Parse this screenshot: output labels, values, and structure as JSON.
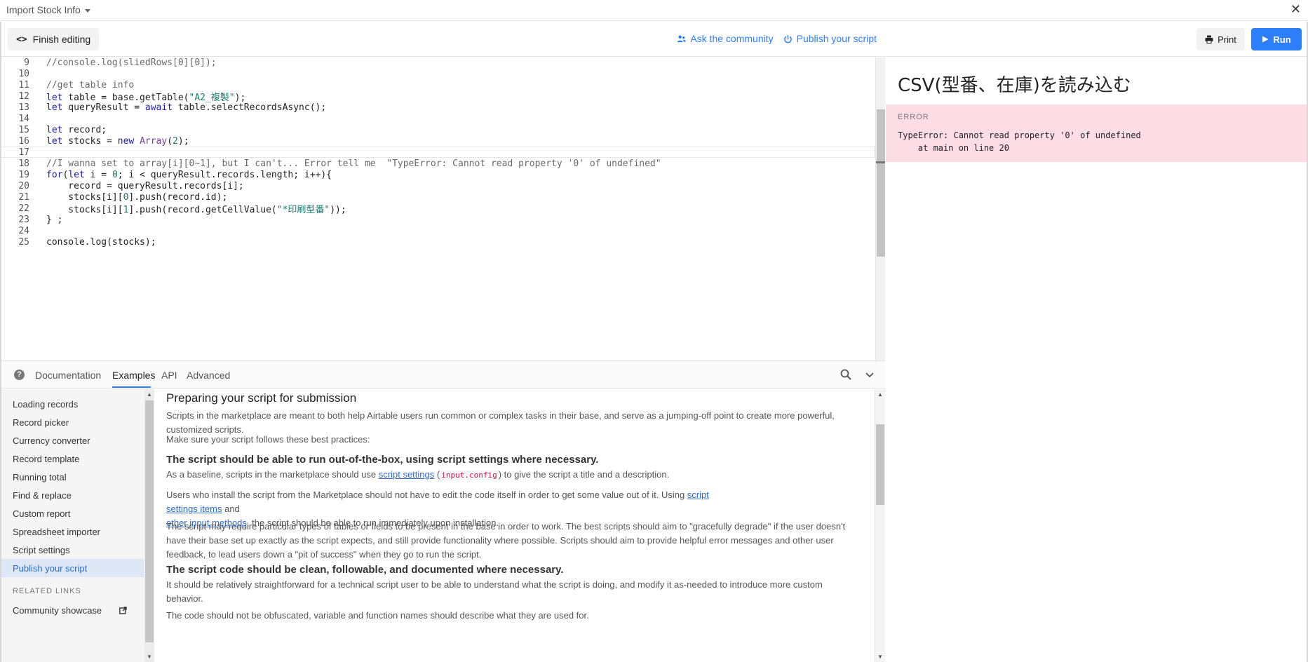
{
  "window": {
    "title": "Import Stock Info",
    "close_glyph": "✕"
  },
  "toolbar": {
    "finish_glyph": "<>",
    "finish_label": "Finish editing",
    "ask_label": "Ask the community",
    "publish_label": "Publish your script"
  },
  "editor": {
    "lines": [
      {
        "n": "9",
        "segs": [
          {
            "t": "//console.log(sliedRows[0][0]);",
            "c": "c-comment"
          }
        ]
      },
      {
        "n": "10",
        "segs": []
      },
      {
        "n": "11",
        "segs": [
          {
            "t": "//get table info",
            "c": "c-comment"
          }
        ]
      },
      {
        "n": "12",
        "segs": [
          {
            "t": "let",
            "c": "c-kw"
          },
          {
            "t": " table = base.getTable(",
            "c": ""
          },
          {
            "t": "\"A2_複製\"",
            "c": "c-str"
          },
          {
            "t": ");",
            "c": ""
          }
        ]
      },
      {
        "n": "13",
        "segs": [
          {
            "t": "let",
            "c": "c-kw"
          },
          {
            "t": " queryResult = ",
            "c": ""
          },
          {
            "t": "await",
            "c": "c-kw"
          },
          {
            "t": " table.selectRecordsAsync();",
            "c": ""
          }
        ]
      },
      {
        "n": "14",
        "segs": []
      },
      {
        "n": "15",
        "segs": [
          {
            "t": "let",
            "c": "c-kw"
          },
          {
            "t": " record;",
            "c": ""
          }
        ]
      },
      {
        "n": "16",
        "segs": [
          {
            "t": "let",
            "c": "c-kw"
          },
          {
            "t": " stocks = ",
            "c": ""
          },
          {
            "t": "new",
            "c": "c-kw"
          },
          {
            "t": " ",
            "c": ""
          },
          {
            "t": "Array",
            "c": "c-type"
          },
          {
            "t": "(",
            "c": ""
          },
          {
            "t": "2",
            "c": "c-num"
          },
          {
            "t": ");",
            "c": ""
          }
        ]
      },
      {
        "n": "17",
        "segs": []
      },
      {
        "n": "18",
        "segs": [
          {
            "t": "//I wanna set to array[i][0~1], but I can't... Error tell me  \"TypeError: Cannot read property '0' of undefined\"",
            "c": "c-comment"
          }
        ]
      },
      {
        "n": "19",
        "segs": [
          {
            "t": "for",
            "c": "c-kw"
          },
          {
            "t": "(",
            "c": ""
          },
          {
            "t": "let",
            "c": "c-kw"
          },
          {
            "t": " i = ",
            "c": ""
          },
          {
            "t": "0",
            "c": "c-num"
          },
          {
            "t": "; i < queryResult.records.length; i++){",
            "c": ""
          }
        ]
      },
      {
        "n": "20",
        "segs": [
          {
            "t": "    record = queryResult.records[i];",
            "c": ""
          }
        ]
      },
      {
        "n": "21",
        "segs": [
          {
            "t": "    stocks[i][",
            "c": ""
          },
          {
            "t": "0",
            "c": "c-num"
          },
          {
            "t": "].push(record.id);",
            "c": ""
          }
        ]
      },
      {
        "n": "22",
        "segs": [
          {
            "t": "    stocks[i][",
            "c": ""
          },
          {
            "t": "1",
            "c": "c-num"
          },
          {
            "t": "].push(record.getCellValue(",
            "c": ""
          },
          {
            "t": "\"*印刷型番\"",
            "c": "c-str"
          },
          {
            "t": "));",
            "c": ""
          }
        ]
      },
      {
        "n": "23",
        "segs": [
          {
            "t": "} ;",
            "c": ""
          }
        ]
      },
      {
        "n": "24",
        "segs": []
      },
      {
        "n": "25",
        "segs": [
          {
            "t": "console.log(stocks);",
            "c": ""
          }
        ]
      }
    ]
  },
  "docs": {
    "help_glyph": "?",
    "tabs": [
      "Documentation",
      "Examples",
      "API",
      "Advanced"
    ],
    "active_tab": "Examples",
    "sidebar": {
      "items": [
        "Loading records",
        "Record picker",
        "Currency converter",
        "Record template",
        "Running total",
        "Find & replace",
        "Custom report",
        "Spreadsheet importer",
        "Script settings",
        "Publish your script"
      ],
      "active_item": "Publish your script",
      "related_heading": "RELATED LINKS",
      "related_items": [
        "Community showcase"
      ]
    },
    "article": {
      "title": "Preparing your script for submission",
      "intro": "Scripts in the marketplace are meant to both help Airtable users run common or complex tasks in their base, and serve as a jumping-off point to create more powerful, customized scripts.",
      "practices_intro": "Make sure your script follows these best practices:",
      "h1": "The script should be able to run out-of-the-box, using script settings where necessary.",
      "p1_a": "As a baseline, scripts in the marketplace should use ",
      "p1_link": "script settings",
      "p1_code": "input.config",
      "p1_b": " to give the script a title and a description.",
      "p2_a": "Users who install the script from the Marketplace should not have to edit the code itself in order to get some value out of it. Using ",
      "p2_link1": "script settings items",
      "p2_b": " and",
      "p2_link2": "other input methods",
      "p2_c": ", the script should be able to run immediately upon installation.",
      "p3": "The script may require particular types of tables or fields to be present in the base in order to work. The best scripts should aim to \"gracefully degrade\" if the user doesn't have their base set up exactly as the script expects, and still provide functionality where possible. Scripts should aim to provide helpful error messages and other user feedback, to lead users down a \"pit of success\" when they go to run the script.",
      "h2": "The script code should be clean, followable, and documented where necessary.",
      "p4": "It should be relatively straightforward for a technical script user to be able to understand what the script is doing, and modify it as-needed to introduce more custom behavior.",
      "p5": "The code should not be obfuscated, variable and function names should describe what they are used for."
    }
  },
  "output": {
    "print_label": "Print",
    "run_label": "Run",
    "title": "CSV(型番、在庫)を読み込む",
    "error_label": "ERROR",
    "error_message": "TypeError: Cannot read property '0' of undefined",
    "error_location": "    at main on line 20"
  },
  "colors": {
    "accent": "#2d7ff9",
    "error_bg": "#fddde5",
    "active_sidebar_bg": "#dde7f6"
  }
}
